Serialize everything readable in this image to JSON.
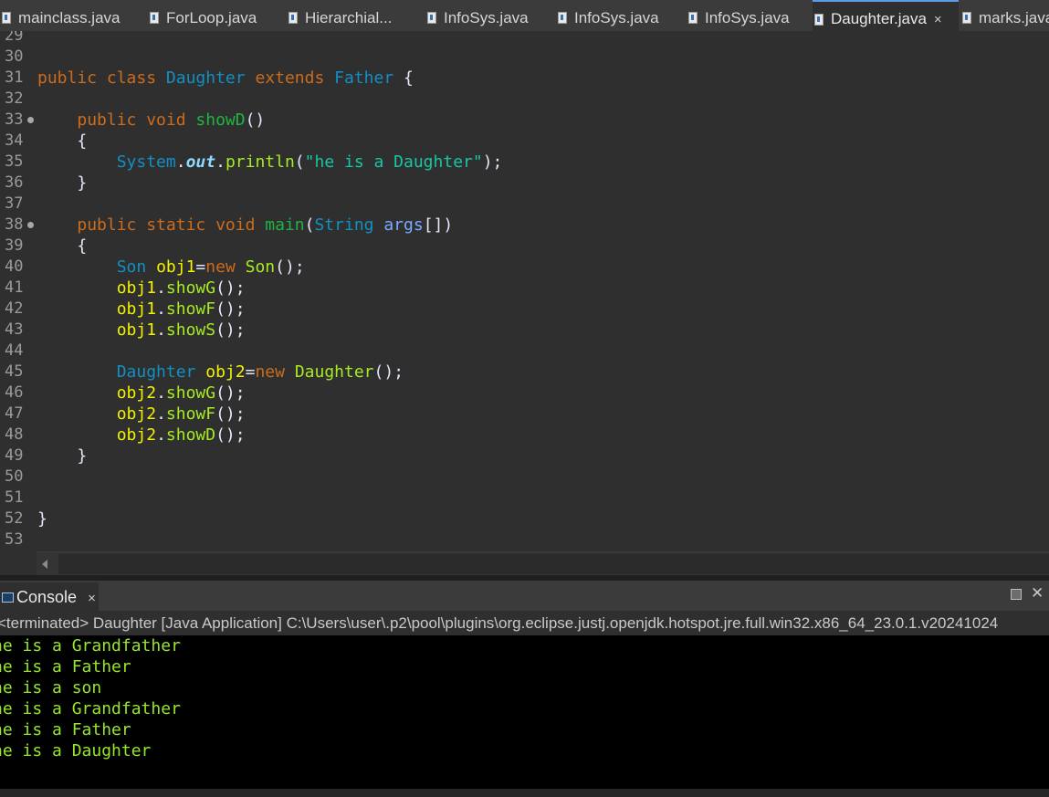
{
  "editor_tabs": [
    {
      "label": "mainclass.java",
      "active": false
    },
    {
      "label": "ForLoop.java",
      "active": false
    },
    {
      "label": "Hierarchial...",
      "active": false
    },
    {
      "label": "InfoSys.java",
      "active": false
    },
    {
      "label": "InfoSys.java",
      "active": false
    },
    {
      "label": "InfoSys.java",
      "active": false
    },
    {
      "label": "Daughter.java",
      "active": true,
      "close": "×"
    },
    {
      "label": "marks.java",
      "active": false
    }
  ],
  "code_lines": [
    {
      "n": "29",
      "tokens": []
    },
    {
      "n": "30",
      "tokens": []
    },
    {
      "n": "31",
      "tokens": [
        [
          "kw",
          "public class "
        ],
        [
          "ty",
          "Daughter "
        ],
        [
          "kw",
          "extends "
        ],
        [
          "ty",
          "Father "
        ],
        [
          "op",
          "{"
        ]
      ]
    },
    {
      "n": "32",
      "tokens": []
    },
    {
      "n": "33",
      "fold": true,
      "tokens": [
        [
          "op",
          "    "
        ],
        [
          "kw",
          "public void "
        ],
        [
          "fn",
          "showD"
        ],
        [
          "op",
          "()"
        ]
      ]
    },
    {
      "n": "34",
      "tokens": [
        [
          "op",
          "    {"
        ]
      ]
    },
    {
      "n": "35",
      "tokens": [
        [
          "op",
          "        "
        ],
        [
          "ty",
          "System"
        ],
        [
          "op",
          "."
        ],
        [
          "fld",
          "out"
        ],
        [
          "op",
          "."
        ],
        [
          "mc",
          "println"
        ],
        [
          "op",
          "("
        ],
        [
          "str",
          "\"he is a Daughter\""
        ],
        [
          "op",
          ");"
        ]
      ]
    },
    {
      "n": "36",
      "tokens": [
        [
          "op",
          "    }"
        ]
      ]
    },
    {
      "n": "37",
      "tokens": []
    },
    {
      "n": "38",
      "fold": true,
      "tokens": [
        [
          "op",
          "    "
        ],
        [
          "kw",
          "public static void "
        ],
        [
          "fn",
          "main"
        ],
        [
          "op",
          "("
        ],
        [
          "ty",
          "String "
        ],
        [
          "prm",
          "args"
        ],
        [
          "op",
          "[])"
        ]
      ]
    },
    {
      "n": "39",
      "tokens": [
        [
          "op",
          "    {"
        ]
      ]
    },
    {
      "n": "40",
      "tokens": [
        [
          "op",
          "        "
        ],
        [
          "ty",
          "Son "
        ],
        [
          "var",
          "obj1"
        ],
        [
          "op",
          "="
        ],
        [
          "kw",
          "new "
        ],
        [
          "mc",
          "Son"
        ],
        [
          "op",
          "();"
        ]
      ]
    },
    {
      "n": "41",
      "tokens": [
        [
          "op",
          "        "
        ],
        [
          "var",
          "obj1"
        ],
        [
          "op",
          "."
        ],
        [
          "mc",
          "showG"
        ],
        [
          "op",
          "();"
        ]
      ]
    },
    {
      "n": "42",
      "tokens": [
        [
          "op",
          "        "
        ],
        [
          "var",
          "obj1"
        ],
        [
          "op",
          "."
        ],
        [
          "mc",
          "showF"
        ],
        [
          "op",
          "();"
        ]
      ]
    },
    {
      "n": "43",
      "tokens": [
        [
          "op",
          "        "
        ],
        [
          "var",
          "obj1"
        ],
        [
          "op",
          "."
        ],
        [
          "mc",
          "showS"
        ],
        [
          "op",
          "();"
        ]
      ]
    },
    {
      "n": "44",
      "tokens": []
    },
    {
      "n": "45",
      "tokens": [
        [
          "op",
          "        "
        ],
        [
          "ty",
          "Daughter "
        ],
        [
          "var",
          "obj2"
        ],
        [
          "op",
          "="
        ],
        [
          "kw",
          "new "
        ],
        [
          "mc",
          "Daughter"
        ],
        [
          "op",
          "();"
        ]
      ]
    },
    {
      "n": "46",
      "tokens": [
        [
          "op",
          "        "
        ],
        [
          "var",
          "obj2"
        ],
        [
          "op",
          "."
        ],
        [
          "mc",
          "showG"
        ],
        [
          "op",
          "();"
        ]
      ]
    },
    {
      "n": "47",
      "tokens": [
        [
          "op",
          "        "
        ],
        [
          "var",
          "obj2"
        ],
        [
          "op",
          "."
        ],
        [
          "mc",
          "showF"
        ],
        [
          "op",
          "();"
        ]
      ]
    },
    {
      "n": "48",
      "tokens": [
        [
          "op",
          "        "
        ],
        [
          "var",
          "obj2"
        ],
        [
          "op",
          "."
        ],
        [
          "mc",
          "showD"
        ],
        [
          "op",
          "();"
        ]
      ]
    },
    {
      "n": "49",
      "tokens": [
        [
          "op",
          "    }"
        ]
      ]
    },
    {
      "n": "50",
      "tokens": []
    },
    {
      "n": "51",
      "tokens": []
    },
    {
      "n": "52",
      "tokens": [
        [
          "op",
          "}"
        ]
      ]
    },
    {
      "n": "53",
      "tokens": []
    }
  ],
  "console": {
    "tab_label": "Console",
    "tab_close": "×",
    "close_glyph": "✕",
    "status": "<terminated> Daughter [Java Application] C:\\Users\\user\\.p2\\pool\\plugins\\org.eclipse.justj.openjdk.hotspot.jre.full.win32.x86_64_23.0.1.v20241024",
    "output": [
      "he is a Grandfather",
      "he is a Father",
      "he is a son",
      "he is a Grandfather",
      "he is a Father",
      "he is a Daughter"
    ]
  },
  "colors": {
    "keyword": "#cc6c1d",
    "type": "#1290c3",
    "method_decl": "#1eb540",
    "string": "#17c6a3",
    "local_var": "#f2f200",
    "method_call": "#a7ec21",
    "console_text": "#96e62c",
    "active_tab_accent": "#5a9be6"
  }
}
